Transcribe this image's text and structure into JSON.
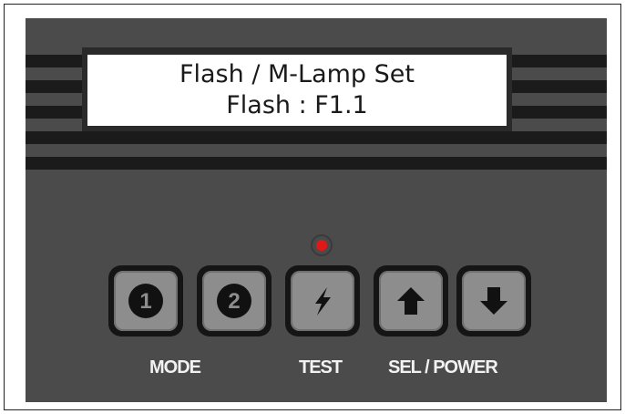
{
  "display": {
    "line1": "Flash / M-Lamp Set",
    "line2": "Flash : F1.1"
  },
  "indicator": {
    "color": "#e01818"
  },
  "buttons": [
    {
      "name": "mode-1-button",
      "icon": "number-one-icon"
    },
    {
      "name": "mode-2-button",
      "icon": "number-two-icon"
    },
    {
      "name": "test-button",
      "icon": "lightning-bolt-icon"
    },
    {
      "name": "up-button",
      "icon": "arrow-up-icon"
    },
    {
      "name": "down-button",
      "icon": "arrow-down-icon"
    }
  ],
  "labels": {
    "mode": "MODE",
    "test": "TEST",
    "sel_power": "SEL / POWER"
  },
  "colors": {
    "panel": "#4b4b4b",
    "stripe": "#1b1b1b",
    "button_face": "#8d8d8d"
  }
}
